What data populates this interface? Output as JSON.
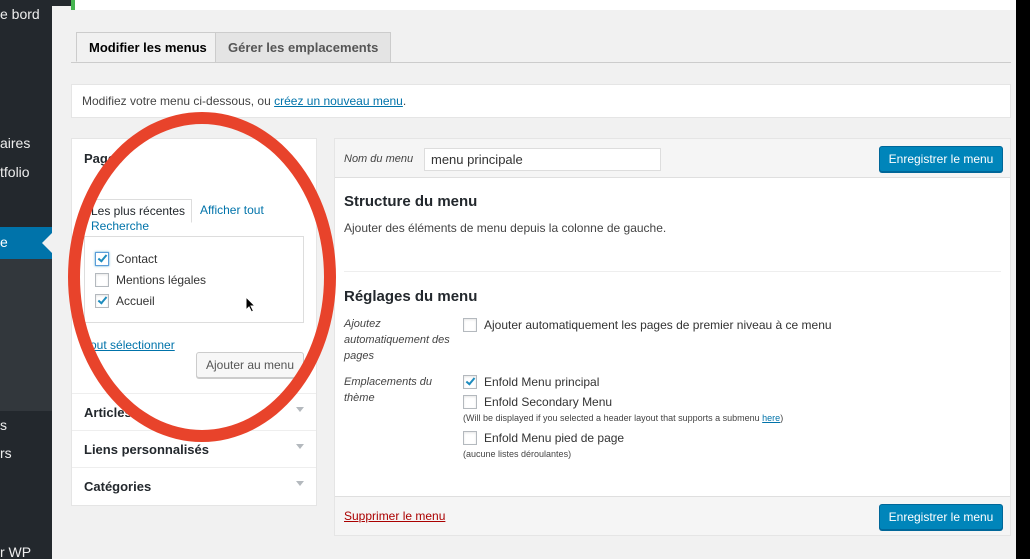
{
  "sidebar": {
    "items": [
      {
        "label": "e bord"
      },
      {
        "label": "aires"
      },
      {
        "label": "tfolio"
      },
      {
        "label": "e"
      },
      {
        "label": "s"
      },
      {
        "label": "rs"
      },
      {
        "label": "r WP"
      }
    ]
  },
  "tabs": [
    {
      "label": "Modifier les menus",
      "active": true
    },
    {
      "label": "Gérer les emplacements",
      "active": false
    }
  ],
  "manage": {
    "text": "Modifiez votre menu ci-dessous, ou ",
    "link": "créez un nouveau menu",
    "suffix": "."
  },
  "left_panel": {
    "pages_title": "Pages",
    "tab_recent": "Les plus récentes",
    "tab_all": "Afficher tout",
    "tab_search": "Recherche",
    "pages": [
      {
        "label": "Contact",
        "checked": true
      },
      {
        "label": "Mentions légales",
        "checked": false
      },
      {
        "label": "Accueil",
        "checked": true
      }
    ],
    "select_all": "Tout sélectionner",
    "add_button": "Ajouter au menu",
    "sections": [
      {
        "label": "Articles"
      },
      {
        "label": "Liens personnalisés"
      },
      {
        "label": "Catégories"
      }
    ]
  },
  "editor": {
    "menu_name_label": "Nom du menu",
    "menu_name_value": "menu principale",
    "save_label": "Enregistrer le menu",
    "structure_title": "Structure du menu",
    "structure_hint": "Ajouter des éléments de menu depuis la colonne de gauche.",
    "settings_title": "Réglages du menu",
    "auto_add_label": "Ajoutez automatiquement des pages",
    "auto_add_option": "Ajouter automatiquement les pages de premier niveau à ce menu",
    "auto_add_checked": false,
    "locations_label": "Emplacements du thème",
    "locations": [
      {
        "label": "Enfold Menu principal",
        "checked": true
      },
      {
        "label": "Enfold Secondary Menu",
        "checked": false
      },
      {
        "label": "Enfold Menu pied de page",
        "checked": false
      }
    ],
    "secondary_note": "(Will be displayed if you selected a header layout that supports a submenu ",
    "secondary_note_link": "here",
    "secondary_note_end": ")",
    "footer_note": "(aucune listes déroulantes)",
    "delete_label": "Supprimer le menu"
  },
  "colors": {
    "annotation": "#e8432b",
    "primary_button": "#0085ba",
    "link": "#0073aa",
    "sidebar_bg": "#23282d",
    "sidebar_active": "#0073aa"
  }
}
